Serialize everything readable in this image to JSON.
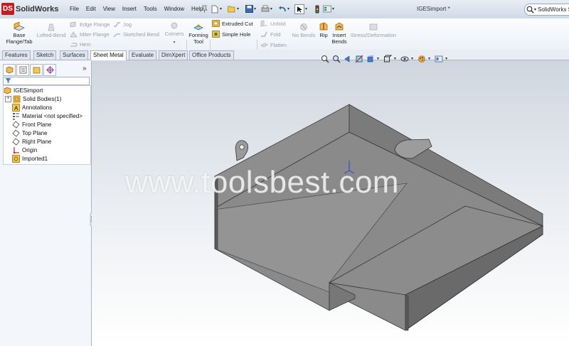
{
  "app": {
    "logo_text": "SolidWorks",
    "document_title": "IGESimport *"
  },
  "menu": [
    "File",
    "Edit",
    "View",
    "Insert",
    "Tools",
    "Window",
    "Help"
  ],
  "search": {
    "value": "SolidWorks Se"
  },
  "ribbon": {
    "base_flange": "Base\nFlange/Tab",
    "lofted_bend": "Lofted-Bend",
    "edge_flange": "Edge Flange",
    "miter_flange": "Miter Flange",
    "hem": "Hem",
    "jog": "Jog",
    "sketched_bend": "Sketched Bend",
    "corners": "Corners",
    "forming_tool": "Forming\nTool",
    "extruded_cut": "Extruded Cut",
    "simple_hole": "Simple Hole",
    "unfold": "Unfold",
    "fold": "Fold",
    "flatten": "Flatten",
    "no_bends": "No Bends",
    "rip": "Rip",
    "insert_bends": "Insert\nBends",
    "stress_deformation": "Stress/Deformation"
  },
  "tabs": [
    "Features",
    "Sketch",
    "Surfaces",
    "Sheet Metal",
    "Evaluate",
    "DimXpert",
    "Office Products"
  ],
  "active_tab": "Sheet Metal",
  "tree": {
    "root": "IGESimport",
    "items": [
      {
        "label": "Solid Bodies(1)",
        "icon": "solid-bodies-icon"
      },
      {
        "label": "Annotations",
        "icon": "annotations-icon"
      },
      {
        "label": "Material <not specified>",
        "icon": "material-icon"
      },
      {
        "label": "Front Plane",
        "icon": "plane-icon"
      },
      {
        "label": "Top Plane",
        "icon": "plane-icon"
      },
      {
        "label": "Right Plane",
        "icon": "plane-icon"
      },
      {
        "label": "Origin",
        "icon": "origin-icon"
      },
      {
        "label": "Imported1",
        "icon": "imported-body-icon"
      }
    ]
  },
  "watermark": "www.toolsbest.com",
  "colors": {
    "brand": "#c21d22",
    "part_face": "#8c8c8c",
    "part_dark": "#5e5e5e"
  }
}
